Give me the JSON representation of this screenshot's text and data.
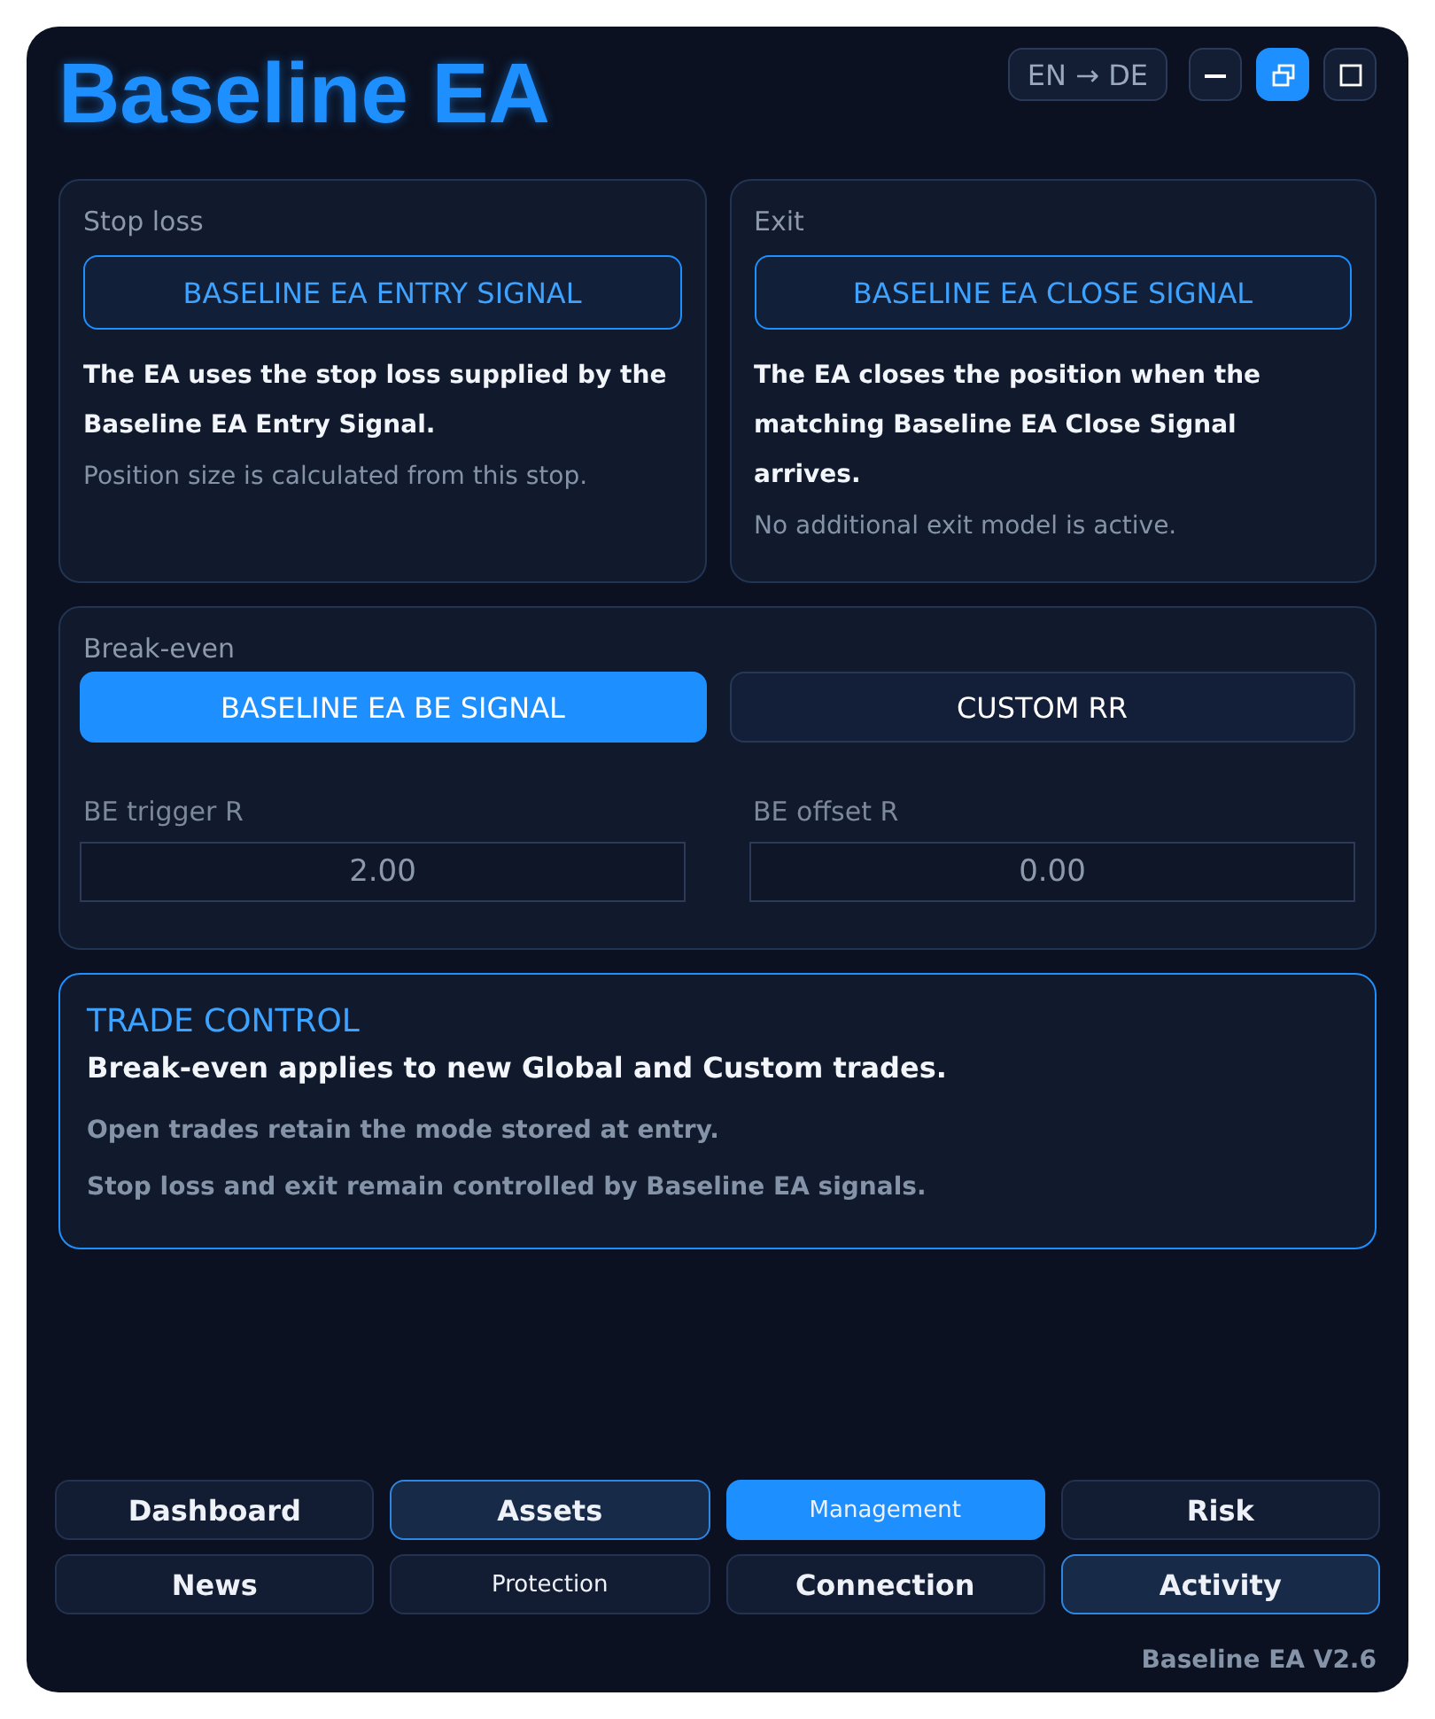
{
  "title": "Baseline EA",
  "language_button": "EN → DE",
  "window_buttons": [
    {
      "kind": "minimize",
      "selected": false
    },
    {
      "kind": "restore",
      "selected": true
    },
    {
      "kind": "maximize",
      "selected": false
    }
  ],
  "cards": [
    {
      "heading": "Stop loss",
      "signal": "BASELINE EA ENTRY SIGNAL",
      "description": "The EA uses the stop loss supplied by the Baseline EA Entry Signal.",
      "note": "Position size is calculated from this stop."
    },
    {
      "heading": "Exit",
      "signal": "BASELINE EA CLOSE SIGNAL",
      "description": "The EA closes the position when the matching Baseline EA Close Signal arrives.",
      "note": "No additional exit model is active."
    }
  ],
  "break_even": {
    "heading": "Break-even",
    "modes": [
      {
        "label": "BASELINE EA BE SIGNAL",
        "selected": true
      },
      {
        "label": "CUSTOM RR",
        "selected": false
      }
    ],
    "fields": [
      {
        "label": "BE trigger R",
        "value": "2.00"
      },
      {
        "label": "BE offset R",
        "value": "0.00"
      }
    ]
  },
  "trade_control": {
    "heading": "TRADE CONTROL",
    "lead": "Break-even applies to new Global and Custom trades.",
    "notes": [
      "Open trades retain the mode stored at entry.",
      "Stop loss and exit remain controlled by Baseline EA signals."
    ]
  },
  "nav_tabs": [
    {
      "label": "Dashboard",
      "selected": false,
      "highlighted": false,
      "small": false
    },
    {
      "label": "Assets",
      "selected": false,
      "highlighted": true,
      "small": false
    },
    {
      "label": "Management",
      "selected": true,
      "highlighted": false,
      "small": true
    },
    {
      "label": "Risk",
      "selected": false,
      "highlighted": false,
      "small": false
    },
    {
      "label": "News",
      "selected": false,
      "highlighted": false,
      "small": false
    },
    {
      "label": "Protection",
      "selected": false,
      "highlighted": false,
      "small": true
    },
    {
      "label": "Connection",
      "selected": false,
      "highlighted": false,
      "small": false
    },
    {
      "label": "Activity",
      "selected": false,
      "highlighted": true,
      "small": false
    }
  ],
  "version": "Baseline EA V2.6"
}
